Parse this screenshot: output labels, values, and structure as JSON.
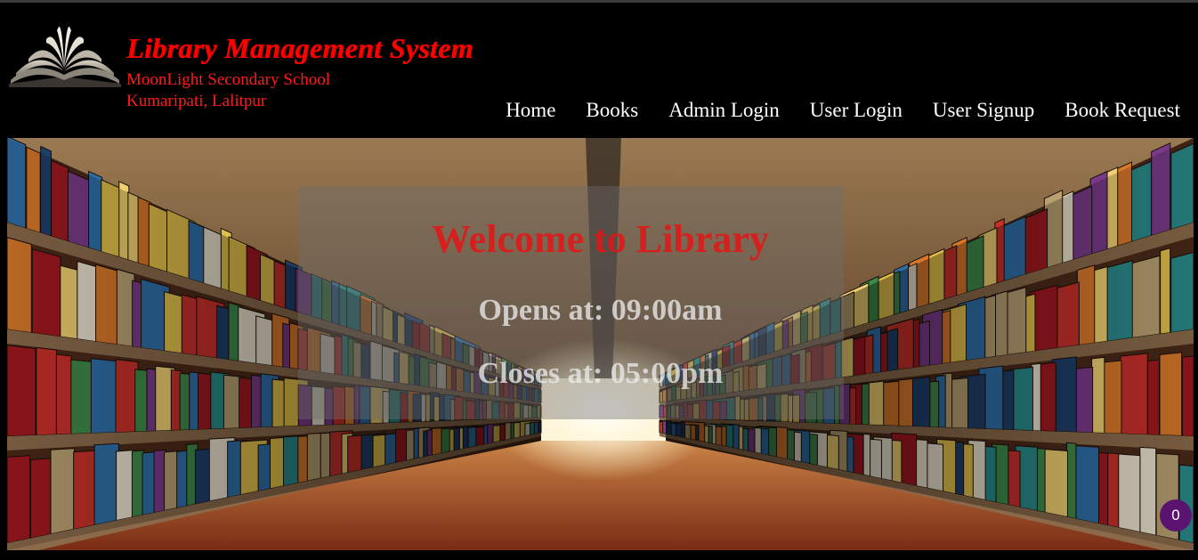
{
  "header": {
    "title": "Library Management System",
    "school_name": "MoonLight Secondary School",
    "school_address": "Kumaripati, Lalitpur",
    "logo_icon": "open-book-icon"
  },
  "nav": {
    "items": [
      {
        "label": "Home"
      },
      {
        "label": "Books"
      },
      {
        "label": "Admin Login"
      },
      {
        "label": "User Login"
      },
      {
        "label": "User Signup"
      },
      {
        "label": "Book Request"
      }
    ]
  },
  "hero": {
    "welcome": "Welcome to Library",
    "opens": "Opens at: 09:00am",
    "closes": "Closes at: 05:00pm",
    "background": "library-bookshelf-aisle-image"
  },
  "badge": {
    "count": "0"
  },
  "colors": {
    "title": "#ff0000",
    "background": "#000000",
    "nav_text": "#ffffff",
    "badge": "#5a1470"
  }
}
